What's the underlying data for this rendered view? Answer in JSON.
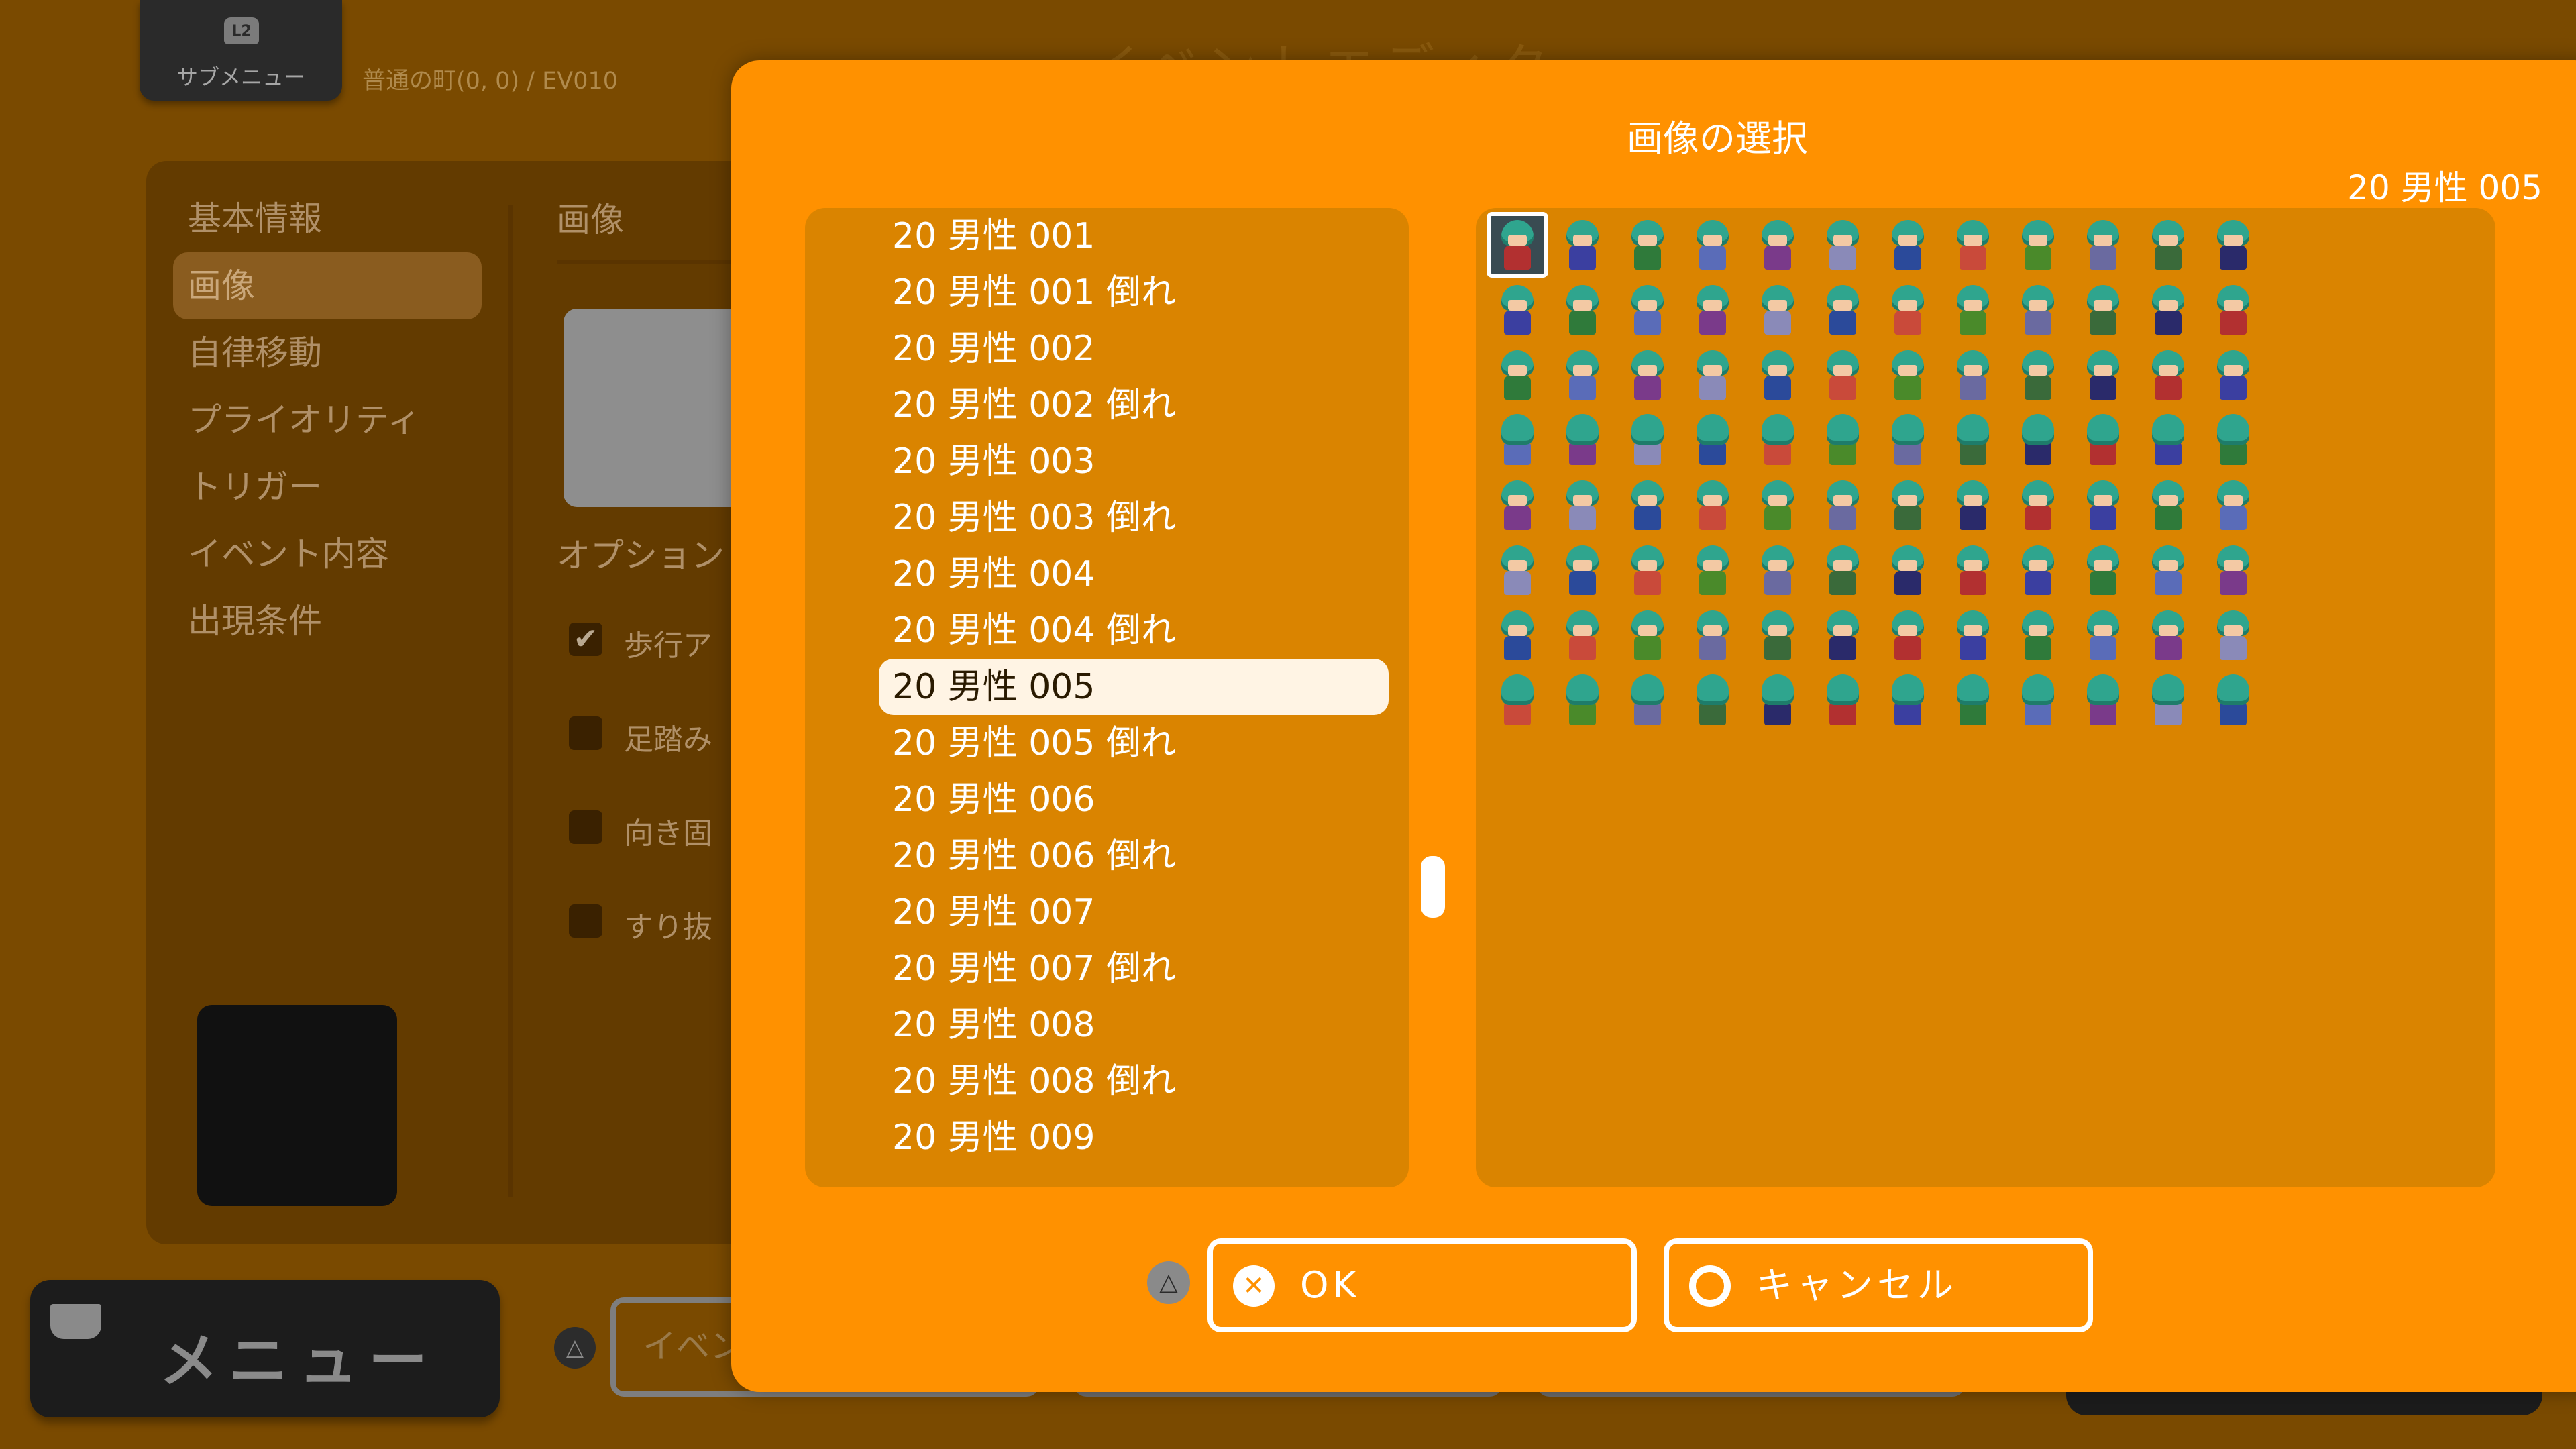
{
  "background": {
    "title": "イベントエディタ",
    "submenu": {
      "badge": "L2",
      "label": "サブメニュー"
    },
    "breadcrumb": "普通の町(0, 0) / EV010",
    "sidebar": {
      "items": [
        {
          "label": "基本情報"
        },
        {
          "label": "画像"
        },
        {
          "label": "自律移動"
        },
        {
          "label": "プライオリティ"
        },
        {
          "label": "トリガー"
        },
        {
          "label": "イベント内容"
        },
        {
          "label": "出現条件"
        }
      ],
      "selected_index": 1
    },
    "section_image": "画像",
    "section_options": "オプション",
    "options": [
      {
        "label": "歩行ア",
        "checked": true
      },
      {
        "label": "足踏み",
        "checked": false
      },
      {
        "label": "向き固",
        "checked": false
      },
      {
        "label": "すり抜",
        "checked": false
      }
    ],
    "menu_label": "メニュー",
    "bottom_button_label": "イベン",
    "triangle_glyph": "△"
  },
  "dialog": {
    "title": "画像の選択",
    "selected_name": "20 男性 005",
    "list": [
      "20 男性 001",
      "20 男性 001 倒れ",
      "20 男性 002",
      "20 男性 002 倒れ",
      "20 男性 003",
      "20 男性 003 倒れ",
      "20 男性 004",
      "20 男性 004 倒れ",
      "20 男性 005",
      "20 男性 005 倒れ",
      "20 男性 006",
      "20 男性 006 倒れ",
      "20 男性 007",
      "20 男性 007 倒れ",
      "20 男性 008",
      "20 男性 008 倒れ",
      "20 男性 009"
    ],
    "selected_index": 8,
    "sprite_sheet": {
      "columns": 12,
      "rows": 8,
      "selected_cell": [
        0,
        0
      ]
    },
    "ok_label": "OK",
    "cancel_label": "キャンセル",
    "triangle_glyph": "△",
    "ok_glyph": "✕"
  },
  "colors": {
    "dialog_bg": "#ff9100",
    "panel_bg": "#da8400",
    "dim_bg": "#7a4a00",
    "selection_bg": "#fff4e4",
    "hair": "#2fa58e"
  },
  "icons": [
    "l2-trigger-icon",
    "triangle-button-icon",
    "cross-button-icon",
    "circle-button-icon",
    "pot-icon",
    "checkmark-icon"
  ]
}
